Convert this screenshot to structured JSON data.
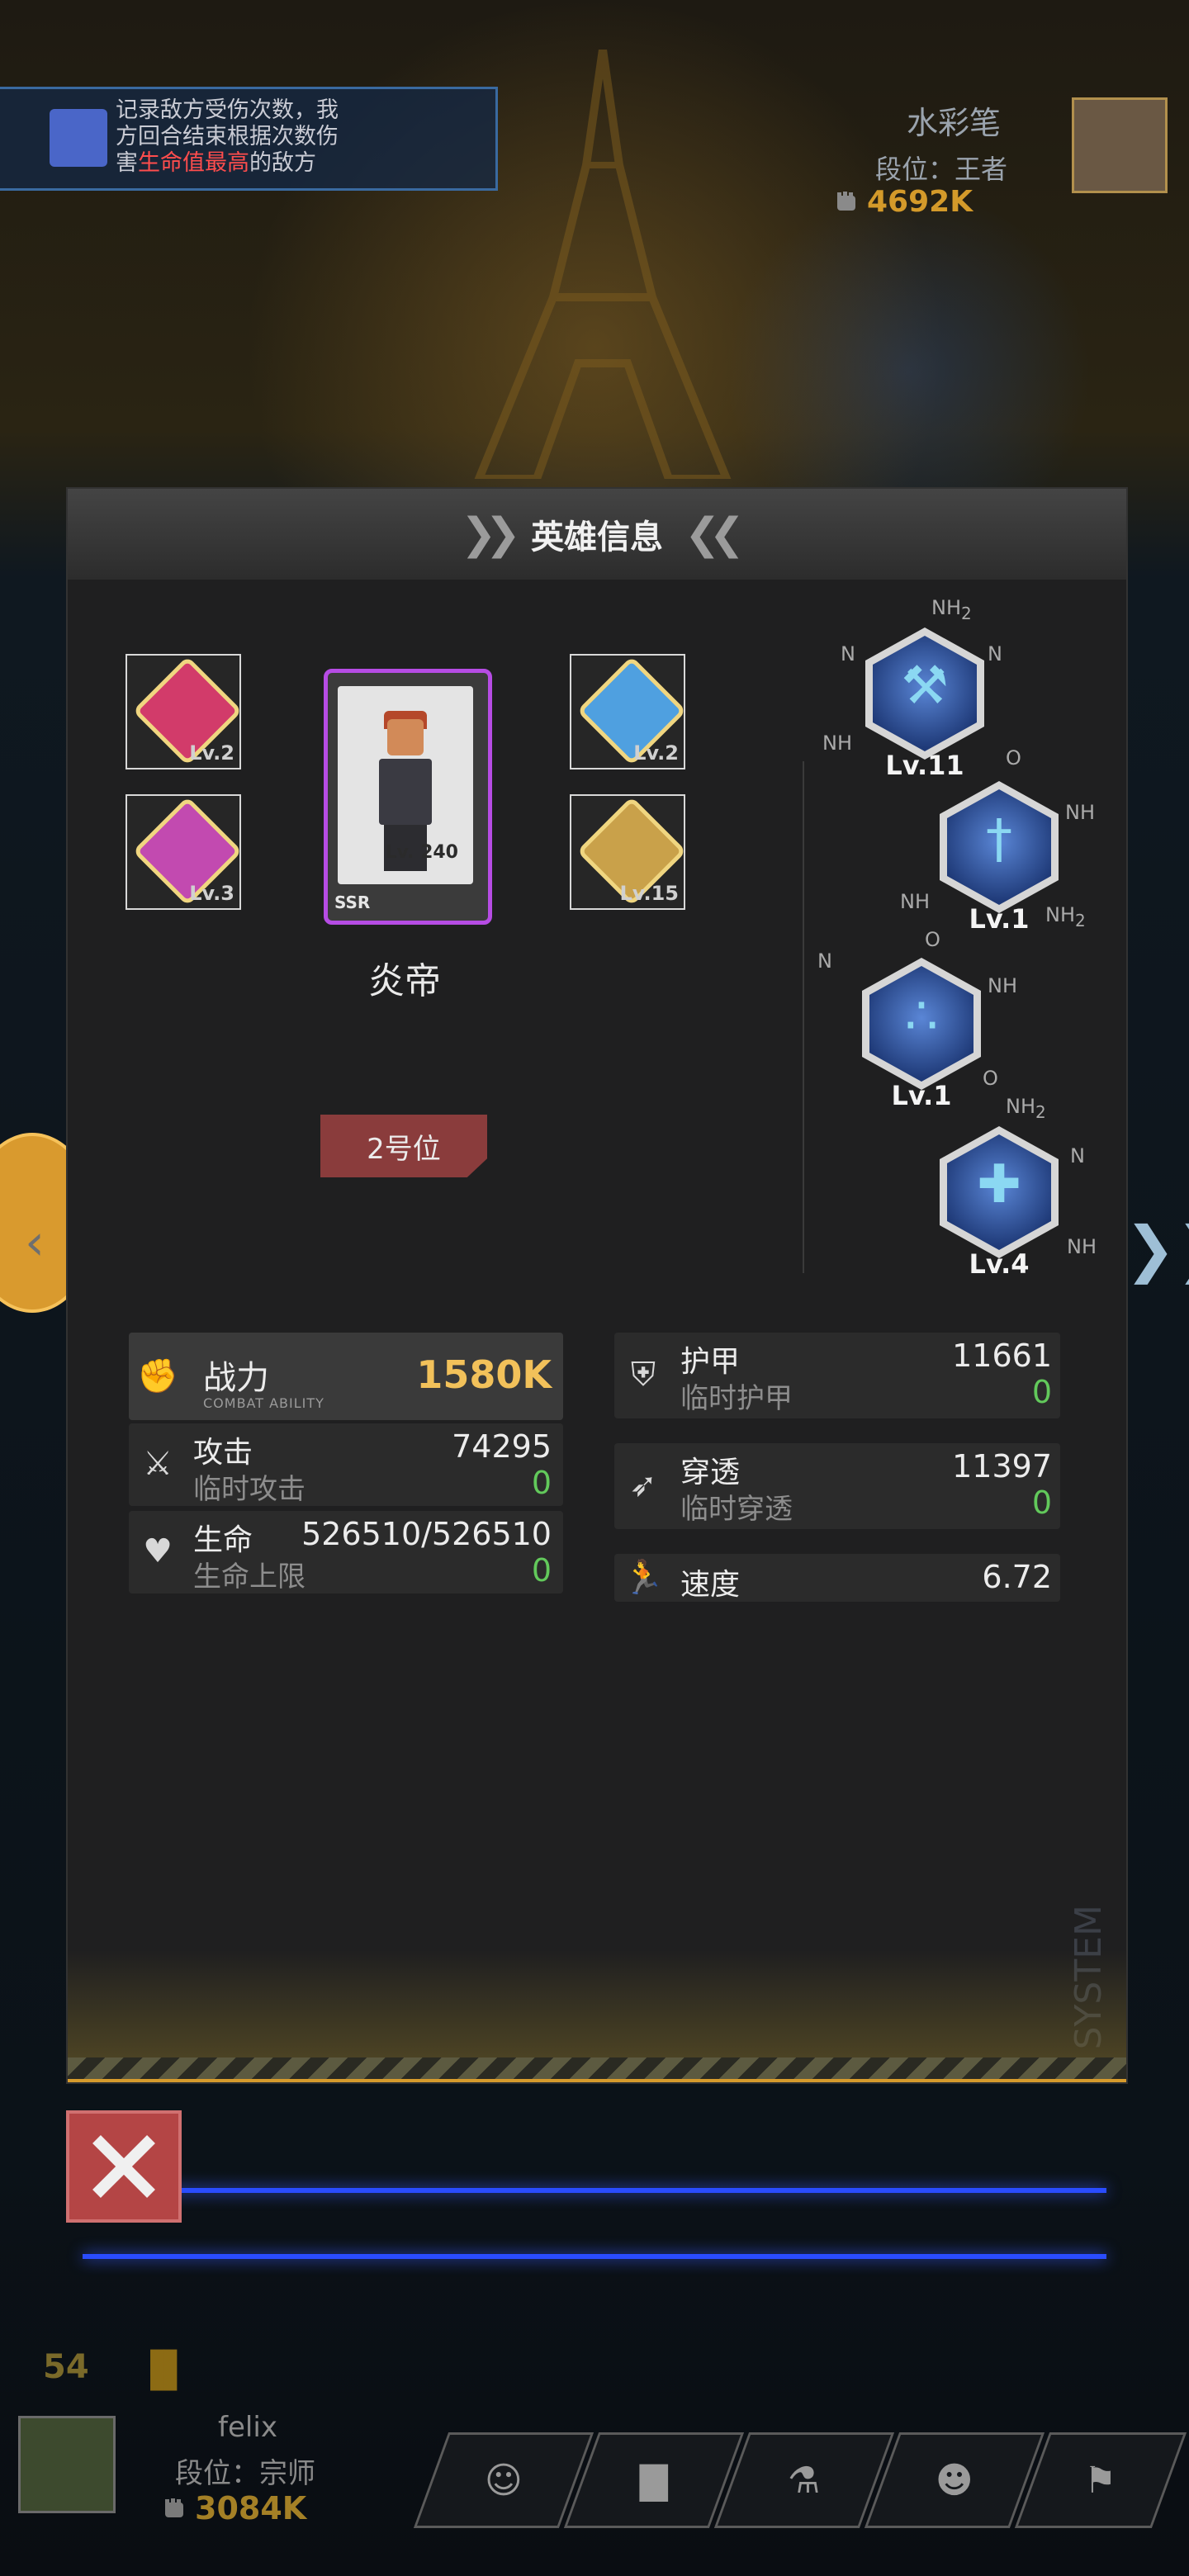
{
  "top_banner": {
    "line1": "记录敌方受伤次数，我",
    "line2": "方回合结束根据次数伤",
    "line3_pre": "害",
    "line3_hl": "生命值最高",
    "line3_post": "的敌方"
  },
  "opponent": {
    "name": "水彩笔",
    "rank": "段位：王者",
    "power": "4692K"
  },
  "modal": {
    "title": "英雄信息",
    "equipment": [
      {
        "level": "Lv.2",
        "color": "#d23b6a"
      },
      {
        "level": "Lv.2",
        "color": "#4fa0e0"
      },
      {
        "level": "Lv.3",
        "color": "#c24ab0"
      },
      {
        "level": "Lv.15",
        "color": "#c9a14a"
      }
    ],
    "hero": {
      "name": "炎帝",
      "grade": "SSR",
      "level": "Lv. 240",
      "position": "2号位"
    },
    "skills": [
      {
        "level": "Lv.11",
        "icon": "wrench-icon"
      },
      {
        "level": "Lv.1",
        "icon": "sword-icon"
      },
      {
        "level": "Lv.1",
        "icon": "claw-icon"
      },
      {
        "level": "Lv.4",
        "icon": "cross-icon"
      }
    ],
    "molecule_labels": {
      "nh2": "NH",
      "sub2": "2",
      "n": "N",
      "nh": "NH",
      "o": "O"
    },
    "stats": {
      "power_label": "战力",
      "power_sub": "COMBAT ABILITY",
      "power_value": "1580K",
      "attack_label": "攻击",
      "attack_value": "74295",
      "temp_attack_label": "临时攻击",
      "temp_attack_value": "0",
      "hp_label": "生命",
      "hp_value": "526510/526510",
      "hp_max_label": "生命上限",
      "hp_max_value": "0",
      "armor_label": "护甲",
      "armor_value": "11661",
      "temp_armor_label": "临时护甲",
      "temp_armor_value": "0",
      "pierce_label": "穿透",
      "pierce_value": "11397",
      "temp_pierce_label": "临时穿透",
      "temp_pierce_value": "0",
      "speed_label": "速度",
      "speed_value": "6.72"
    },
    "watermark": "SYSTEM"
  },
  "bottom": {
    "counter": "54",
    "player_name": "felix",
    "player_rank": "段位：宗师",
    "player_power": "3084K"
  },
  "colors": {
    "accent_gold": "#f2c15a",
    "green": "#62c95b",
    "ssr_purple": "#b64ce4",
    "close_red": "#b44545"
  }
}
